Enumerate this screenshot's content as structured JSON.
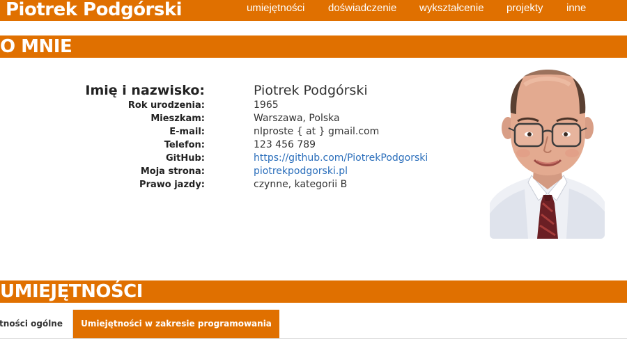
{
  "header": {
    "brand": "Piotrek Podgórski",
    "nav": [
      "umiejętności",
      "doświadczenie",
      "wykształcenie",
      "projekty",
      "inne"
    ]
  },
  "about": {
    "title": "O MNIE",
    "rows": [
      {
        "label": "Imię i nazwisko:",
        "value": "Piotrek Podgórski"
      },
      {
        "label": "Rok urodzenia:",
        "value": "1965"
      },
      {
        "label": "Mieszkam:",
        "value": "Warszawa, Polska"
      },
      {
        "label": "E-mail:",
        "value": "nIproste { at } gmail.com"
      },
      {
        "label": "Telefon:",
        "value": "123 456 789"
      },
      {
        "label": "GitHub:",
        "value": "https://github.com/PiotrekPodgorski"
      },
      {
        "label": "Moja strona:",
        "value": "piotrekpodgorski.pl"
      },
      {
        "label": "Prawo jazdy:",
        "value": "czynne, kategorii B"
      }
    ]
  },
  "skills": {
    "title": "UMIEJĘTNOŚCI",
    "tabs": [
      "Umiejętności ogólne",
      "Umiejętności w zakresie programowania"
    ],
    "active_tab": "Umiejętności w zakresie programowania"
  },
  "colors": {
    "accent": "#e07000",
    "link": "#2a6ebb"
  }
}
